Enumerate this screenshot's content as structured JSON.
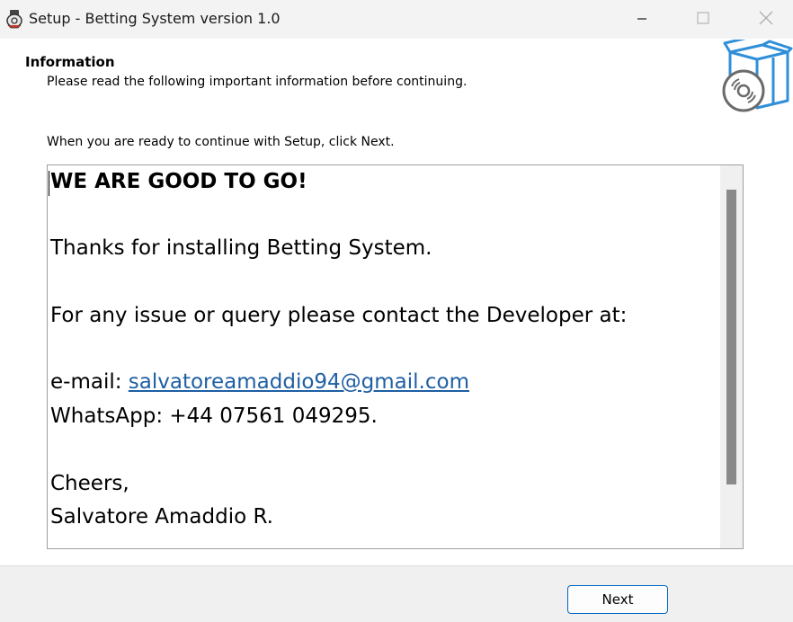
{
  "window": {
    "title": "Setup - Betting System version 1.0",
    "icons": [
      "installer-app-icon",
      "minimize-icon",
      "maximize-icon",
      "close-icon"
    ]
  },
  "header": {
    "title": "Information",
    "subtitle": "Please read the following important information before continuing.",
    "image": "software-box-disc-icon"
  },
  "instruction": "When you are ready to continue with Setup, click Next.",
  "memo": {
    "heading": "WE ARE GOOD TO GO!",
    "thanks": "Thanks for installing Betting System.",
    "contact": "For any issue or query please contact the Developer at:",
    "email_label": "e-mail: ",
    "email": "salvatoreamaddio94@gmail.com",
    "whatsapp": "WhatsApp: +44 07561 049295.",
    "cheers": "Cheers,",
    "signature": "Salvatore Amaddio R."
  },
  "footer": {
    "next_label": "Next"
  },
  "colors": {
    "link": "#1f5fa3",
    "button_border": "#0067c0",
    "box_blue": "#2f8fd8",
    "titlebar": "#f3f3f3"
  }
}
